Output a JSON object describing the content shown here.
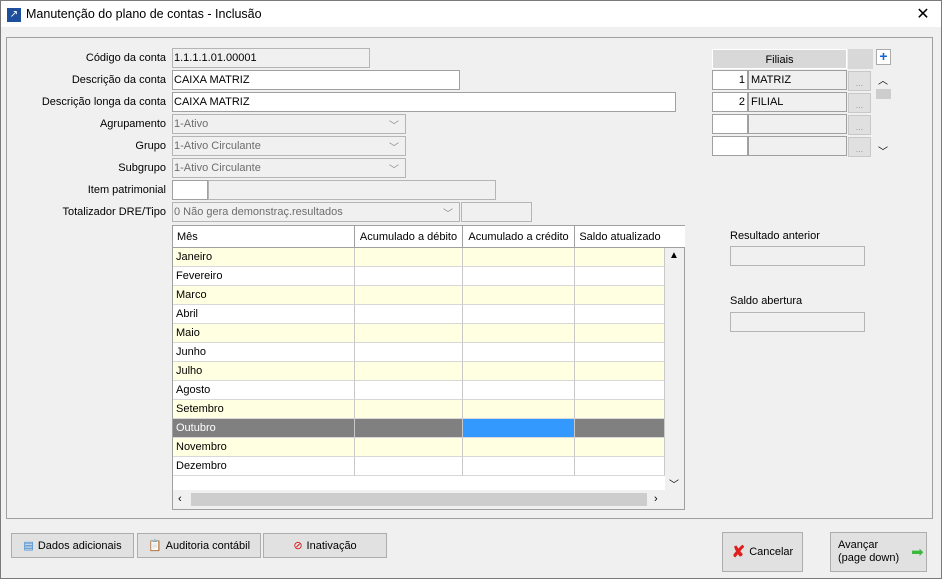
{
  "window": {
    "title": "Manutenção do plano de contas - Inclusão",
    "close": "✕"
  },
  "form": {
    "codigo": {
      "label": "Código da conta",
      "value": "1.1.1.1.01.00001"
    },
    "descricao": {
      "label": "Descrição da conta",
      "value": "CAIXA MATRIZ"
    },
    "descricao_longa": {
      "label": "Descrição longa da conta",
      "value": "CAIXA MATRIZ"
    },
    "agrupamento": {
      "label": "Agrupamento",
      "value": "1-Ativo"
    },
    "grupo": {
      "label": "Grupo",
      "value": "1-Ativo Circulante"
    },
    "subgrupo": {
      "label": "Subgrupo",
      "value": "1-Ativo Circulante"
    },
    "item_patrimonial": {
      "label": "Item patrimonial",
      "code": "",
      "value": ""
    },
    "totalizador": {
      "label": "Totalizador DRE/Tipo",
      "value": "0 Não gera demonstraç.resultados",
      "extra": ""
    }
  },
  "filiais": {
    "header": "Filiais",
    "rows": [
      {
        "num": "1",
        "name": "MATRIZ"
      },
      {
        "num": "2",
        "name": "FILIAL"
      },
      {
        "num": "",
        "name": ""
      },
      {
        "num": "",
        "name": ""
      }
    ],
    "dots": "...",
    "add_icon": "plus-icon"
  },
  "grid": {
    "columns": [
      "Mês",
      "Acumulado a débito",
      "Acumulado a crédito",
      "Saldo atualizado"
    ],
    "rows": [
      "Janeiro",
      "Fevereiro",
      "Marco",
      "Abril",
      "Maio",
      "Junho",
      "Julho",
      "Agosto",
      "Setembro",
      "Outubro",
      "Novembro",
      "Dezembro"
    ],
    "selected_row": "Outubro",
    "row_alt_color": "#ffffe1",
    "selected_color": "#808080",
    "focus_color": "#3399ff"
  },
  "side": {
    "resultado_anterior": {
      "label": "Resultado anterior",
      "value": ""
    },
    "saldo_abertura": {
      "label": "Saldo abertura",
      "value": ""
    }
  },
  "buttons": {
    "dados": "Dados adicionais",
    "auditoria": "Auditoria contábil",
    "inativacao": "Inativação",
    "cancelar": "Cancelar",
    "avancar": "Avançar",
    "avancar_sub": "(page down)"
  }
}
